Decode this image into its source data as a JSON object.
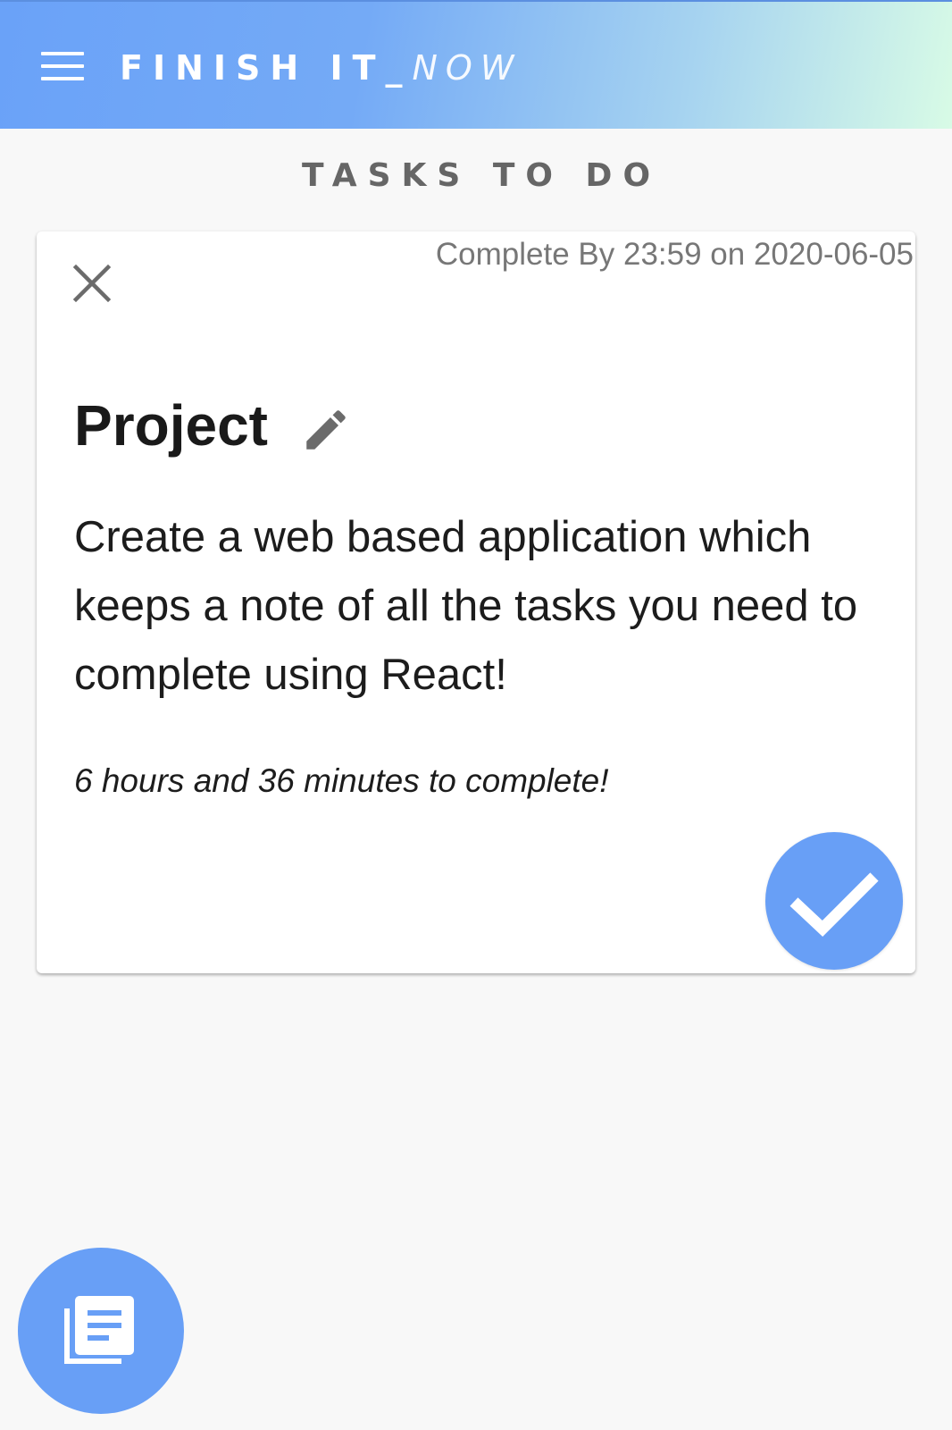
{
  "app_bar": {
    "title_bold": "FINISH IT_",
    "title_light": "NOW",
    "menu_icon": "hamburger-menu-icon"
  },
  "section": {
    "heading": "TASKS TO DO"
  },
  "task": {
    "deadline": "Complete By 23:59 on 2020-06-05",
    "title": "Project",
    "description": "Create a web based application which keeps a note of all the tasks you need to complete using React!",
    "time_left": "6 hours and 36 minutes to complete!",
    "icons": {
      "close": "close-icon",
      "edit": "pencil-icon",
      "complete": "checkmark-icon"
    }
  },
  "fab": {
    "icon": "notes-list-icon"
  },
  "colors": {
    "accent": "#689ff6",
    "header_start": "#6aa2f8",
    "header_end": "#d8fbe6",
    "background": "#f8f8f8",
    "heading_text": "#666666",
    "deadline_text": "#777777"
  }
}
